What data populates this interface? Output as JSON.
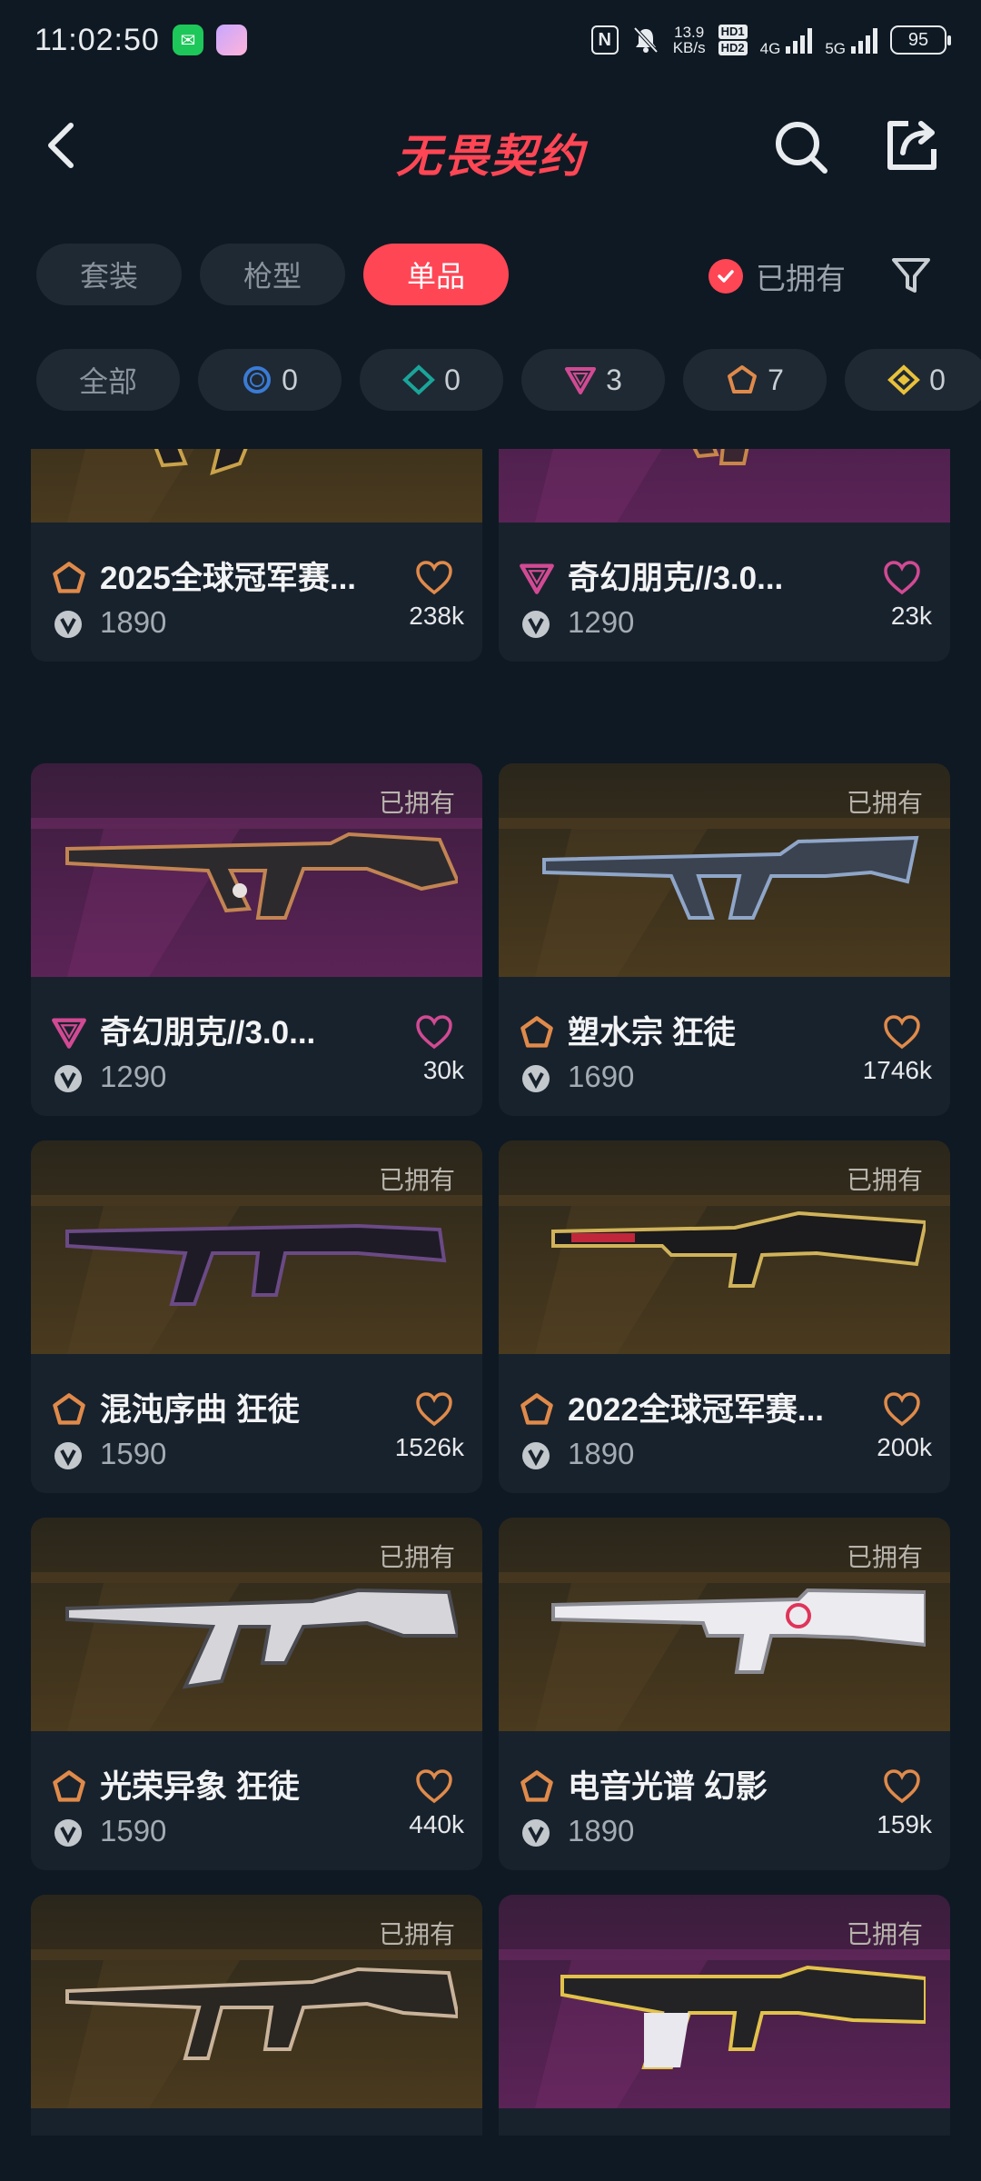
{
  "status_bar": {
    "time": "11:02:50",
    "speed_top": "13.9",
    "speed_unit": "KB/s",
    "hd1": "HD1",
    "hd2": "HD2",
    "net1": "4G",
    "net2": "5G",
    "battery": "95"
  },
  "header": {
    "title": "无畏契约"
  },
  "tabs": [
    {
      "label": "套装",
      "active": false
    },
    {
      "label": "枪型",
      "active": false
    },
    {
      "label": "单品",
      "active": true
    }
  ],
  "owned_filter": {
    "label": "已拥有",
    "checked": true
  },
  "rarity_chips": {
    "all": "全部",
    "select": "0",
    "deluxe": "0",
    "premium": "3",
    "exclusive": "7",
    "ultra": "0"
  },
  "items": [
    {
      "name": "2025全球冠军赛...",
      "price": "1890",
      "likes": "238k",
      "rarity": "exclusive",
      "owned_label": "",
      "bg": "gold",
      "accent": "#c9a24a"
    },
    {
      "name": "奇幻朋克//3.0...",
      "price": "1290",
      "likes": "23k",
      "rarity": "premium",
      "owned_label": "",
      "bg": "purple",
      "accent": "#c7864a"
    },
    {
      "name": "奇幻朋克//3.0...",
      "price": "1290",
      "likes": "30k",
      "rarity": "premium",
      "owned_label": "已拥有",
      "bg": "purple",
      "accent": "#c28452"
    },
    {
      "name": "塑水宗 狂徒",
      "price": "1690",
      "likes": "1746k",
      "rarity": "exclusive",
      "owned_label": "已拥有",
      "bg": "gold",
      "accent": "#8fa6c9"
    },
    {
      "name": "混沌序曲 狂徒",
      "price": "1590",
      "likes": "1526k",
      "rarity": "exclusive",
      "owned_label": "已拥有",
      "bg": "gold",
      "accent": "#6b4a86"
    },
    {
      "name": "2022全球冠军赛...",
      "price": "1890",
      "likes": "200k",
      "rarity": "exclusive",
      "owned_label": "已拥有",
      "bg": "gold",
      "accent": "#d0b35a"
    },
    {
      "name": "光荣异象 狂徒",
      "price": "1590",
      "likes": "440k",
      "rarity": "exclusive",
      "owned_label": "已拥有",
      "bg": "gold",
      "accent": "#d9d9dd"
    },
    {
      "name": "电音光谱 幻影",
      "price": "1890",
      "likes": "159k",
      "rarity": "exclusive",
      "owned_label": "已拥有",
      "bg": "gold",
      "accent": "#e8e8ee"
    },
    {
      "name": "",
      "price": "",
      "likes": "",
      "rarity": "exclusive",
      "owned_label": "已拥有",
      "bg": "gold",
      "accent": "#c9b39a"
    },
    {
      "name": "",
      "price": "",
      "likes": "",
      "rarity": "premium",
      "owned_label": "已拥有",
      "bg": "purple",
      "accent": "#e2c24a"
    }
  ]
}
